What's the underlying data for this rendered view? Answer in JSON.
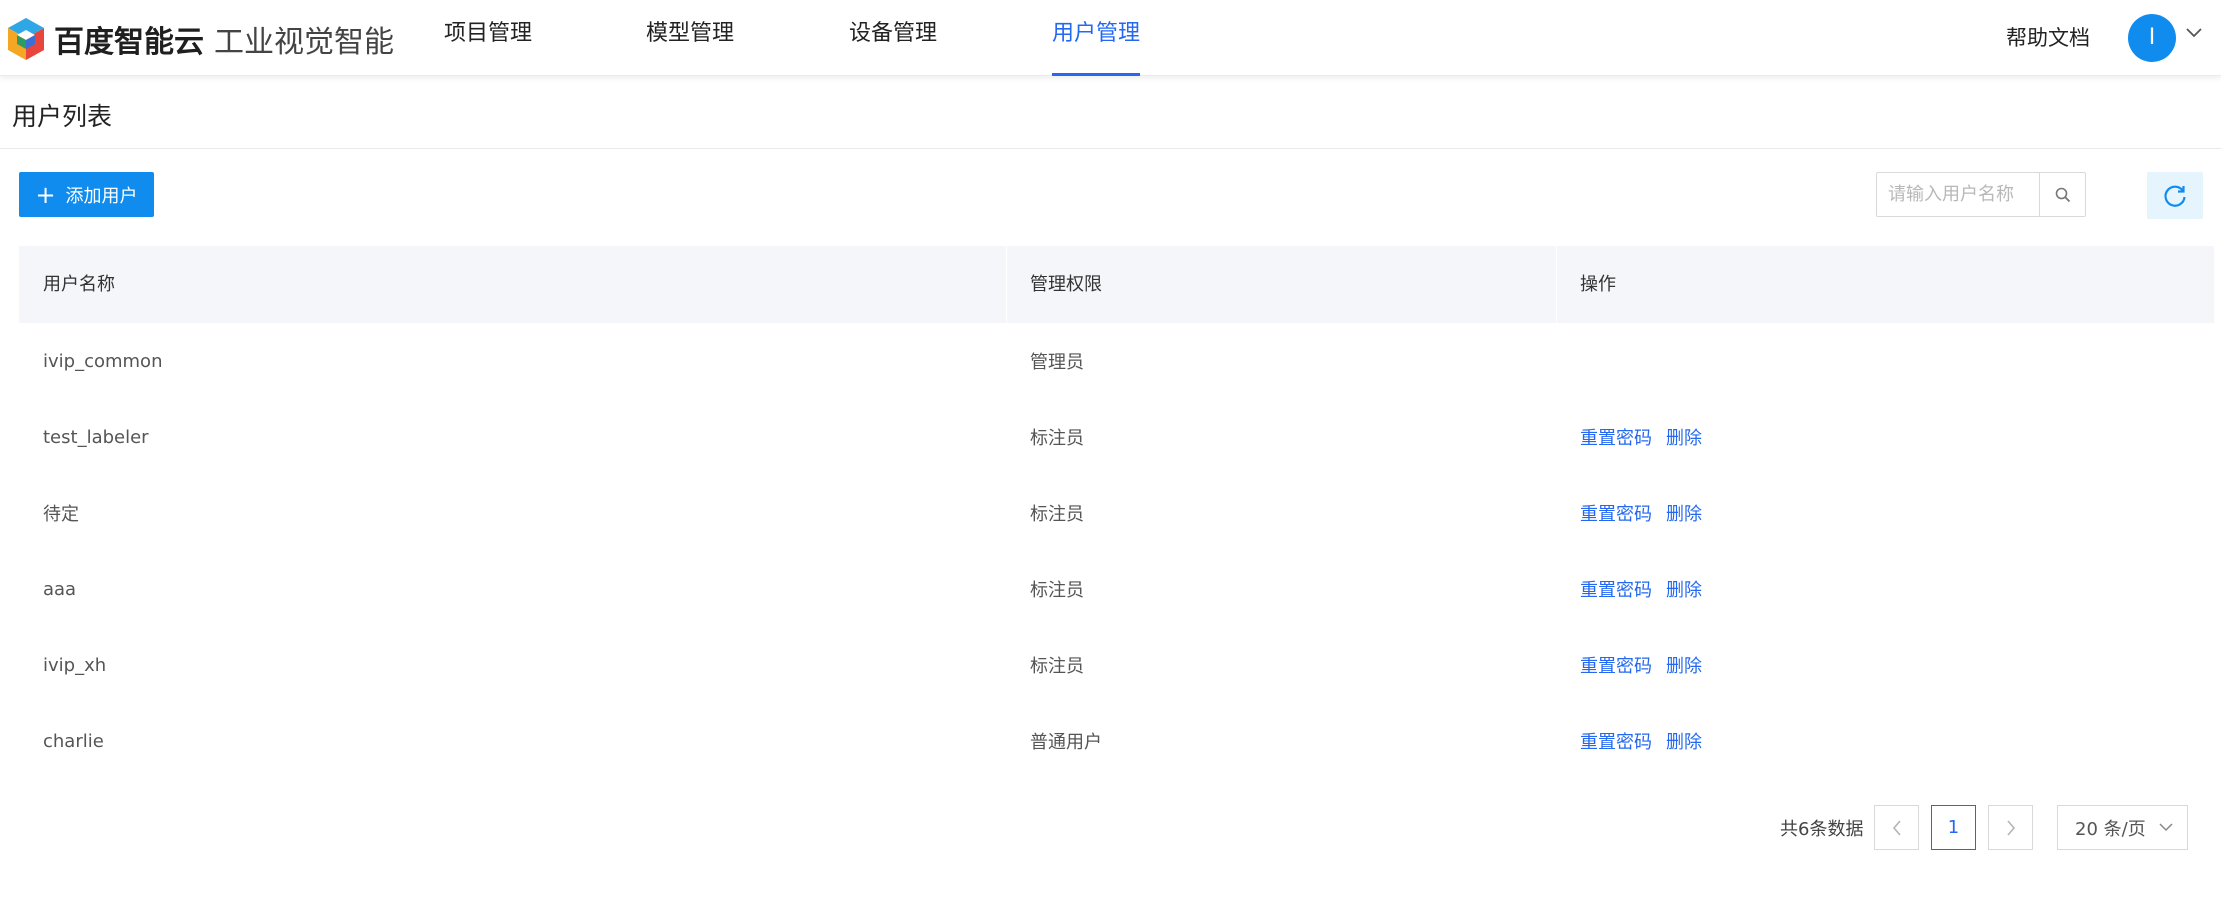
{
  "header": {
    "brand_main": "百度智能云",
    "brand_sub": "工业视觉智能",
    "nav": [
      {
        "label": "项目管理",
        "active": false
      },
      {
        "label": "模型管理",
        "active": false
      },
      {
        "label": "设备管理",
        "active": false
      },
      {
        "label": "用户管理",
        "active": true
      }
    ],
    "help_label": "帮助文档",
    "avatar_letter": "I",
    "accent_color": "#2468f2"
  },
  "page": {
    "title": "用户列表"
  },
  "toolbar": {
    "add_label": "添加用户",
    "search_placeholder": "请输入用户名称",
    "search_value": ""
  },
  "table": {
    "columns": [
      "用户名称",
      "管理权限",
      "操作"
    ],
    "rows": [
      {
        "name": "ivip_common",
        "role": "管理员",
        "actions": []
      },
      {
        "name": "test_labeler",
        "role": "标注员",
        "actions": [
          "重置密码",
          "删除"
        ]
      },
      {
        "name": "待定",
        "role": "标注员",
        "actions": [
          "重置密码",
          "删除"
        ]
      },
      {
        "name": "aaa",
        "role": "标注员",
        "actions": [
          "重置密码",
          "删除"
        ]
      },
      {
        "name": "ivip_xh",
        "role": "标注员",
        "actions": [
          "重置密码",
          "删除"
        ]
      },
      {
        "name": "charlie",
        "role": "普通用户",
        "actions": [
          "重置密码",
          "删除"
        ]
      }
    ]
  },
  "pagination": {
    "total_text": "共6条数据",
    "current_page": "1",
    "page_size": "20 条/页"
  }
}
